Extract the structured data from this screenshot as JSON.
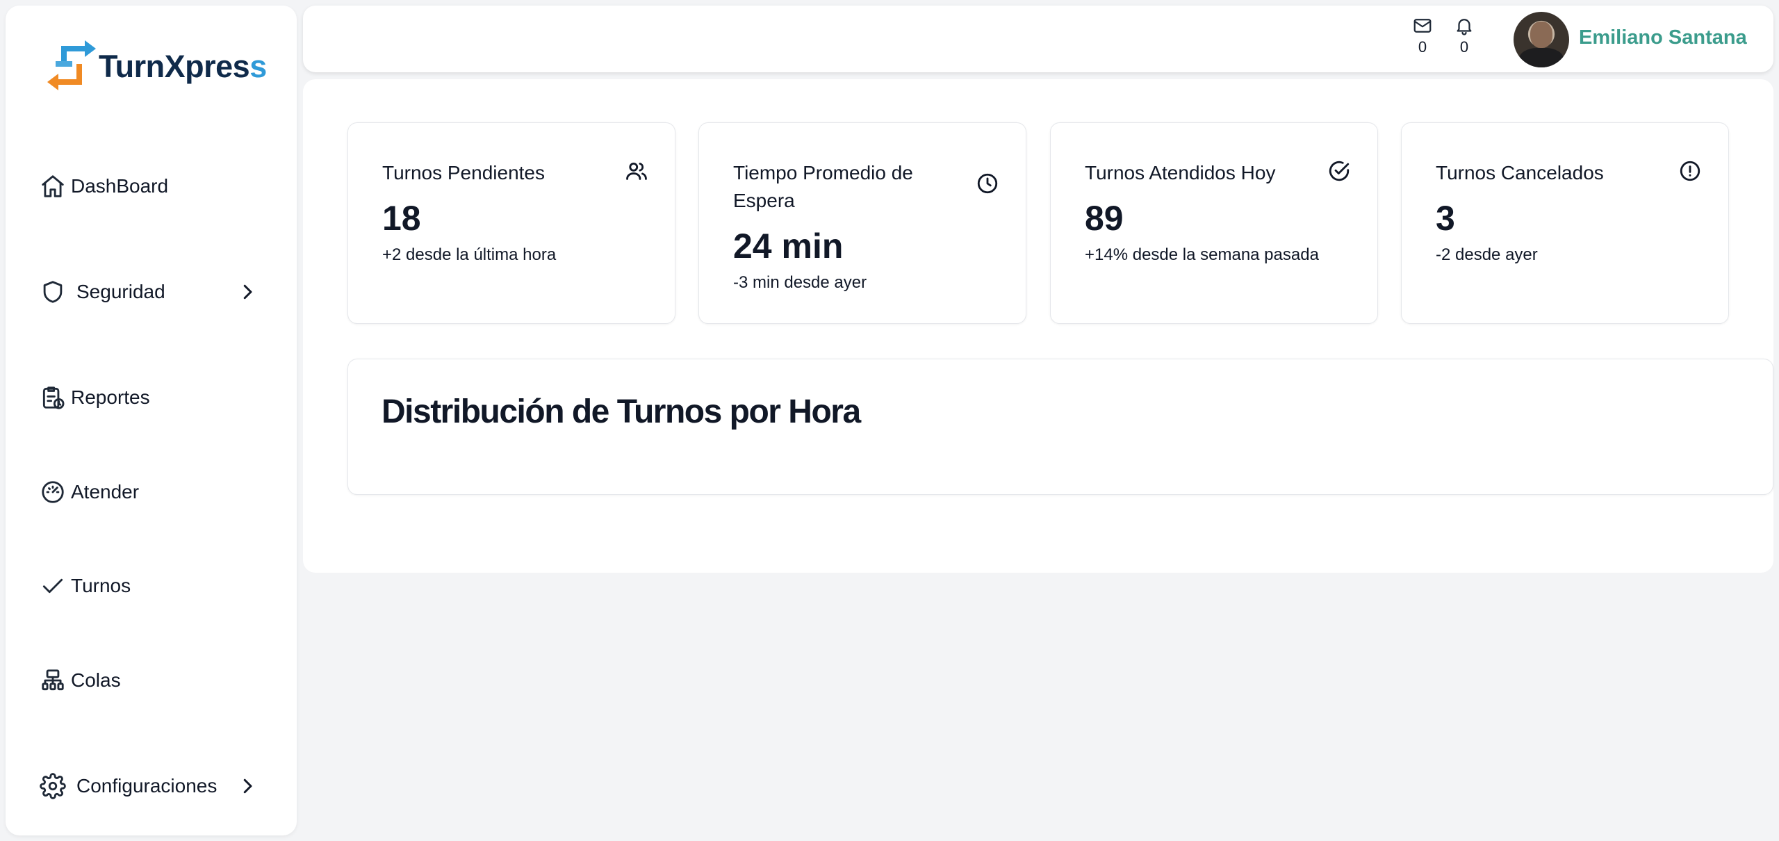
{
  "brand": {
    "name_main": "TurnXpres",
    "name_accent": "s"
  },
  "sidebar": {
    "items": [
      {
        "label": "DashBoard",
        "icon": "home-icon",
        "has_submenu": false
      },
      {
        "label": "Seguridad",
        "icon": "shield-icon",
        "has_submenu": true
      },
      {
        "label": "Reportes",
        "icon": "clipboard-clock-icon",
        "has_submenu": false
      },
      {
        "label": "Atender",
        "icon": "gauge-icon",
        "has_submenu": false
      },
      {
        "label": "Turnos",
        "icon": "check-icon",
        "has_submenu": false
      },
      {
        "label": "Colas",
        "icon": "hierarchy-icon",
        "has_submenu": false
      },
      {
        "label": "Configuraciones",
        "icon": "gear-icon",
        "has_submenu": true
      }
    ]
  },
  "header": {
    "messages_count": "0",
    "notifications_count": "0",
    "user_name": "Emiliano Santana"
  },
  "stats": [
    {
      "title": "Turnos Pendientes",
      "value": "18",
      "sub": "+2 desde la última hora",
      "icon": "users-icon"
    },
    {
      "title": "Tiempo Promedio de Espera",
      "value": "24 min",
      "sub": "-3 min desde ayer",
      "icon": "clock-icon"
    },
    {
      "title": "Turnos Atendidos Hoy",
      "value": "89",
      "sub": "+14% desde la semana pasada",
      "icon": "check-circle-icon"
    },
    {
      "title": "Turnos Cancelados",
      "value": "3",
      "sub": "-2 desde ayer",
      "icon": "alert-circle-icon"
    }
  ],
  "distribution": {
    "title": "Distribución de Turnos por Hora"
  },
  "colors": {
    "brand_dark": "#0f2a4a",
    "brand_blue": "#2f9ad8",
    "brand_orange": "#f08a24",
    "user_name": "#3b9c8c",
    "background": "#f3f4f6"
  }
}
